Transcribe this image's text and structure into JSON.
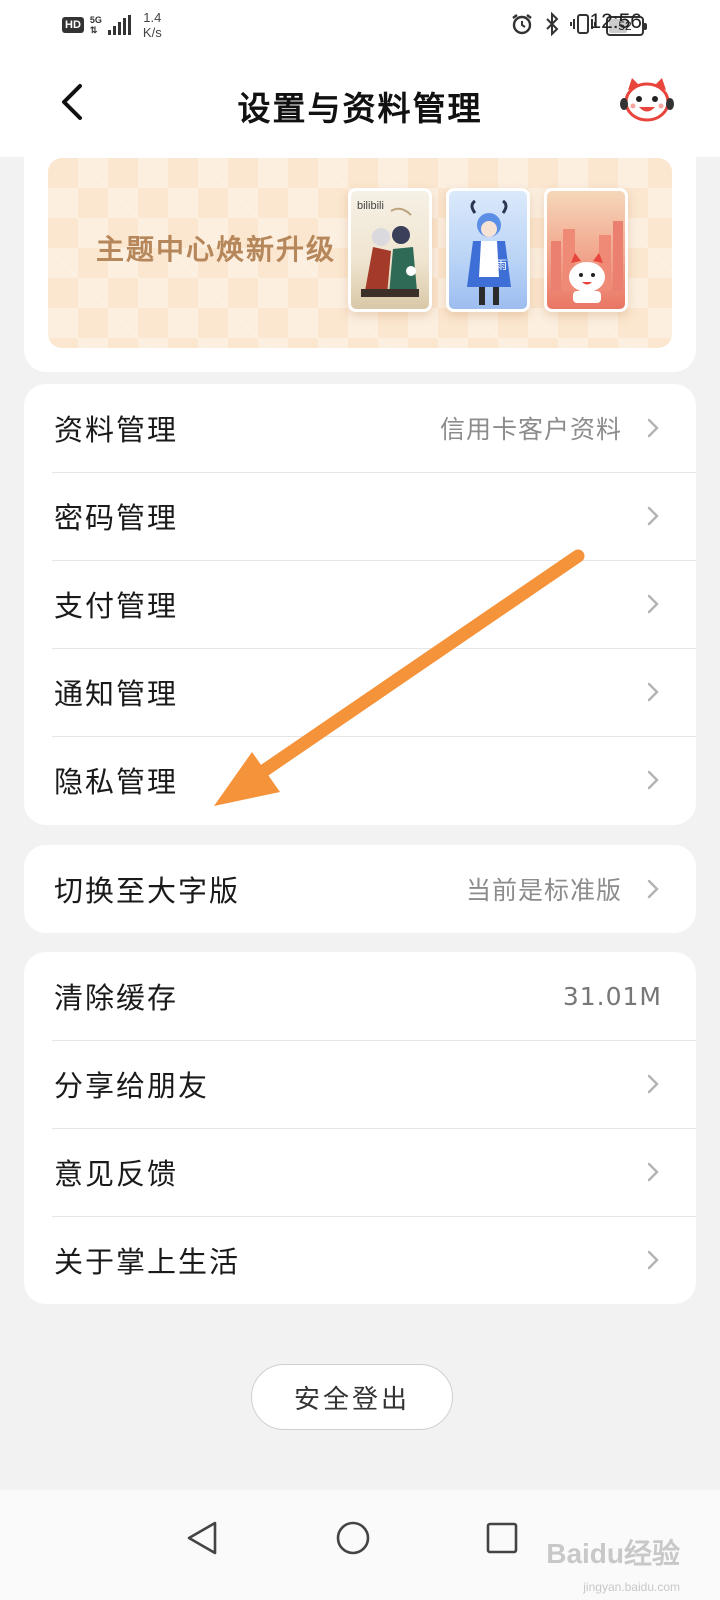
{
  "status_bar": {
    "hd": "HD",
    "network": "5G",
    "speed_value": "1.4",
    "speed_unit": "K/s",
    "battery": "52",
    "time": "12:56"
  },
  "header": {
    "title": "设置与资料管理"
  },
  "banner": {
    "text": "主题中心焕新升级",
    "thumb_1_brand": "bilibili",
    "thumb_2_label": "甘雨"
  },
  "management": {
    "items": [
      {
        "label": "资料管理",
        "value": "信用卡客户资料"
      },
      {
        "label": "密码管理",
        "value": ""
      },
      {
        "label": "支付管理",
        "value": ""
      },
      {
        "label": "通知管理",
        "value": ""
      },
      {
        "label": "隐私管理",
        "value": ""
      }
    ]
  },
  "font_mode": {
    "label": "切换至大字版",
    "value": "当前是标准版"
  },
  "misc": {
    "items": [
      {
        "label": "清除缓存",
        "value": "31.01M"
      },
      {
        "label": "分享给朋友",
        "value": ""
      },
      {
        "label": "意见反馈",
        "value": ""
      },
      {
        "label": "关于掌上生活",
        "value": ""
      }
    ]
  },
  "logout": {
    "label": "安全登出"
  },
  "watermark": {
    "text": "Baidu经验",
    "sub": "jingyan.baidu.com"
  },
  "colors": {
    "accent_arrow": "#f5933b",
    "banner_text": "#b5875a",
    "background": "#f2f2f2"
  }
}
